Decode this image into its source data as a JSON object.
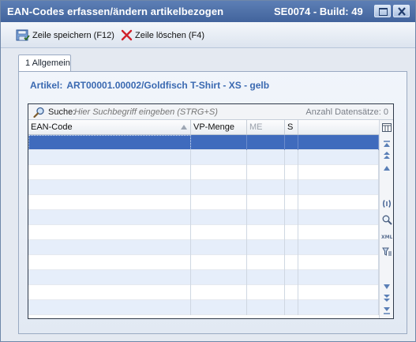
{
  "window": {
    "title": "EAN-Codes erfassen/ändern artikelbezogen",
    "build": "SE0074 - Build: 49"
  },
  "toolbar": {
    "save_label": "Zeile speichern (F12)",
    "delete_label": "Zeile löschen (F4)"
  },
  "tabs": [
    {
      "label": "1 Allgemein"
    }
  ],
  "article": {
    "label": "Artikel:",
    "value": "ART00001.00002/Goldfisch T-Shirt - XS - gelb"
  },
  "search": {
    "label": "Suche:",
    "placeholder": "Hier Suchbegriff eingeben (STRG+S)",
    "count": "Anzahl Datensätze: 0"
  },
  "grid": {
    "columns": [
      "EAN-Code",
      "VP-Menge",
      "ME",
      "S"
    ],
    "rows": [
      [
        "",
        "",
        "",
        ""
      ],
      [
        "",
        "",
        "",
        ""
      ],
      [
        "",
        "",
        "",
        ""
      ],
      [
        "",
        "",
        "",
        ""
      ],
      [
        "",
        "",
        "",
        ""
      ],
      [
        "",
        "",
        "",
        ""
      ],
      [
        "",
        "",
        "",
        ""
      ],
      [
        "",
        "",
        "",
        ""
      ],
      [
        "",
        "",
        "",
        ""
      ],
      [
        "",
        "",
        "",
        ""
      ],
      [
        "",
        "",
        "",
        ""
      ],
      [
        "",
        "",
        "",
        ""
      ]
    ],
    "selected_row": 0
  },
  "side_toolbar": [
    "column-chooser-icon",
    "first-record-icon",
    "previous-page-icon",
    "previous-record-icon",
    "brackets-icon",
    "find-icon",
    "xml-export-icon",
    "filter-icon",
    "next-record-icon",
    "next-page-icon",
    "last-record-icon"
  ]
}
